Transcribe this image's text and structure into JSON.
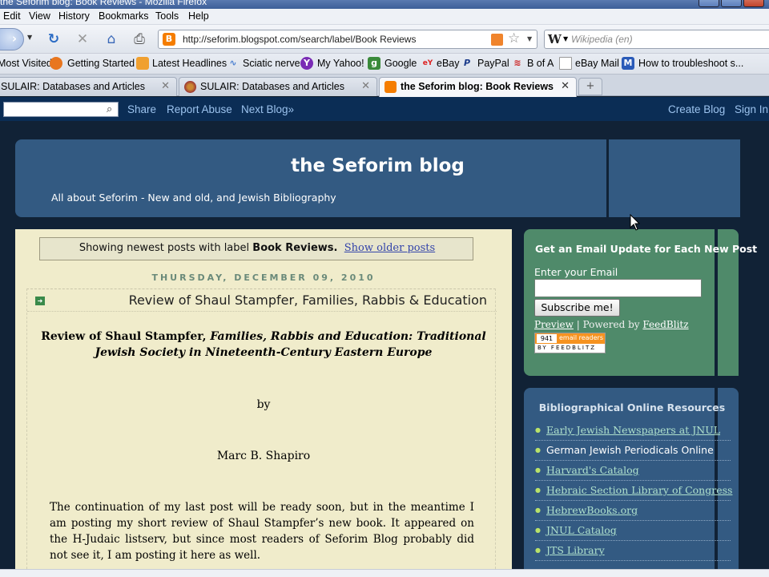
{
  "window": {
    "title": "the Seforim blog: Book Reviews - Mozilla Firefox"
  },
  "menu": [
    "Edit",
    "View",
    "History",
    "Bookmarks",
    "Tools",
    "Help"
  ],
  "nav": {
    "url": "http://seforim.blogspot.com/search/label/Book Reviews",
    "search_engine": "W",
    "search_placeholder": "Wikipedia (en)"
  },
  "bookmarks": [
    {
      "label": "Most Visited",
      "icon": "none"
    },
    {
      "label": "Getting Started",
      "icon": "firefox-icon"
    },
    {
      "label": "Latest Headlines",
      "icon": "rss-icon"
    },
    {
      "label": "Sciatic nerve",
      "icon": "link-icon"
    },
    {
      "label": "My Yahoo!",
      "icon": "yahoo-icon"
    },
    {
      "label": "Google",
      "icon": "google-icon"
    },
    {
      "label": "eBay",
      "icon": "ebay-icon"
    },
    {
      "label": "PayPal",
      "icon": "paypal-icon"
    },
    {
      "label": "B of A",
      "icon": "bofa-icon"
    },
    {
      "label": "eBay Mail",
      "icon": "page-icon"
    },
    {
      "label": "How to troubleshoot s...",
      "icon": "m-icon"
    }
  ],
  "tabs": [
    {
      "label": "SULAIR: Databases and Articles",
      "active": false
    },
    {
      "label": "SULAIR: Databases and Articles",
      "active": false
    },
    {
      "label": "the Seforim blog: Book Reviews",
      "active": true
    }
  ],
  "blogger_nav": {
    "share": "Share",
    "report": "Report Abuse",
    "next": "Next Blog»",
    "create": "Create Blog",
    "signin": "Sign In"
  },
  "header": {
    "title": "the Seforim blog",
    "description": "All about Seforim - New and old, and Jewish Bibliography"
  },
  "status": {
    "prefix": "Showing newest posts with label",
    "label": "Book Reviews.",
    "older": "Show older posts"
  },
  "post": {
    "date": "THURSDAY, DECEMBER 09, 2010",
    "title": "Review of Shaul Stampfer, Families, Rabbis & Education",
    "heading_plain": "Review of Shaul Stampfer, ",
    "heading_italic_1": "Families, Rabbis and Education: Traditional",
    "heading_italic_2": "Jewish Society in Nineteenth-Century Eastern Europe",
    "by": "by",
    "author": "Marc B. Shapiro",
    "paragraph": "The continuation of my last post will be ready soon, but in the meantime I am posting my short review of Shaul Stampfer’s new book. It appeared on the H-Judaic listserv, but since most readers of Seforim Blog probably did not see it, I am posting it here as well."
  },
  "email_widget": {
    "heading": "Get an Email Update for Each New Post",
    "label": "Enter your Email",
    "button": "Subscribe me!",
    "preview": "Preview",
    "powered": " | Powered by ",
    "feedblitz": "FeedBlitz",
    "readers_count": "941",
    "readers_label": "email readers",
    "by_line": "BY FEEDBLITZ"
  },
  "resources": {
    "heading": "Bibliographical Online Resources",
    "items": [
      "Early Jewish Newspapers at JNUL",
      "German Jewish Periodicals Online",
      "Harvard's Catalog",
      "Hebraic Section Library of Congress",
      "HebrewBooks.org",
      "JNUL Catalog",
      "JTS Library"
    ]
  },
  "colors": {
    "header_bg": "#335a82",
    "main_bg": "#f0eccb",
    "sidebar_green": "#4f8a6a",
    "blogger_bar": "#0b2d55"
  }
}
